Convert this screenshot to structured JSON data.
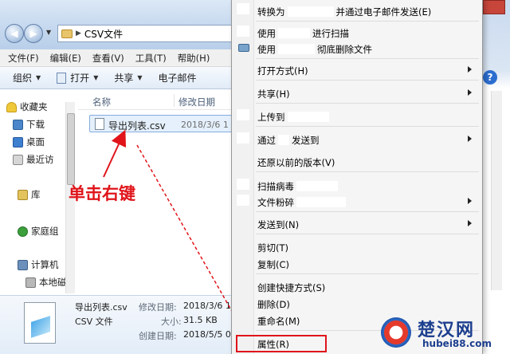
{
  "window": {
    "breadcrumb": "CSV文件",
    "menu": [
      "文件(F)",
      "编辑(E)",
      "查看(V)",
      "工具(T)",
      "帮助(H)"
    ],
    "toolbar": {
      "organize": "组织",
      "open": "打开",
      "share": "共享",
      "email": "电子邮件"
    }
  },
  "sidebar": {
    "items": [
      "收藏夹",
      "下载",
      "桌面",
      "最近访",
      "库",
      "家庭组",
      "计算机",
      "本地磁"
    ]
  },
  "list": {
    "col_name": "名称",
    "col_date": "修改日期",
    "file": {
      "name": "导出列表.csv",
      "date": "2018/3/6 1"
    }
  },
  "annotation": "单击右键",
  "details": {
    "filename": "导出列表.csv",
    "type": "CSV 文件",
    "modified_label": "修改日期:",
    "modified_value": "2018/3/6 1",
    "size_label": "大小:",
    "size_value": "31.5 KB",
    "created_label": "创建日期:",
    "created_value": "2018/5/5 0"
  },
  "context_menu": {
    "convert_pre": "转换为",
    "convert_post": "并通过电子邮件发送(E)",
    "use1_pre": "使用",
    "use1_post": "进行扫描",
    "use2_pre": "使用",
    "use2_post": "彻底删除文件",
    "open_with": "打开方式(H)",
    "share": "共享(H)",
    "upload": "上传到",
    "via_pre": "通过",
    "via_post": "发送到",
    "restore": "还原以前的版本(V)",
    "scan_virus": "扫描病毒",
    "shred": "文件粉碎",
    "send_to": "发送到(N)",
    "cut": "剪切(T)",
    "copy": "复制(C)",
    "create_shortcut": "创建快捷方式(S)",
    "delete": "删除(D)",
    "rename": "重命名(M)",
    "properties": "属性(R)"
  },
  "watermark": {
    "cn": "楚汉网",
    "url": "hubei88.com"
  },
  "colors": {
    "annotation_red": "#e0141a",
    "selection_blue": "#e5f0fc"
  }
}
